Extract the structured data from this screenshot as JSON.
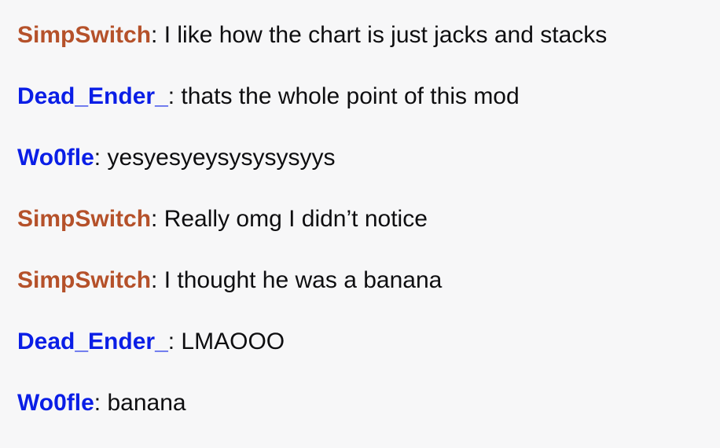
{
  "messages": [
    {
      "user": "SimpSwitch",
      "user_color": "#b5512a",
      "separator": ": ",
      "text": "I like how the chart is just jacks and stacks"
    },
    {
      "user": "Dead_Ender_",
      "user_color": "#0a1ee6",
      "separator": ": ",
      "text": "thats the whole point of this mod"
    },
    {
      "user": "Wo0fle",
      "user_color": "#0a1ee6",
      "separator": ": ",
      "text": "yesyesyeysysysysyys"
    },
    {
      "user": "SimpSwitch",
      "user_color": "#b5512a",
      "separator": ": ",
      "text": "Really omg I didn’t notice"
    },
    {
      "user": "SimpSwitch",
      "user_color": "#b5512a",
      "separator": ": ",
      "text": "I thought he was a banana"
    },
    {
      "user": "Dead_Ender_",
      "user_color": "#0a1ee6",
      "separator": ": ",
      "text": "LMAOOO"
    },
    {
      "user": "Wo0fle",
      "user_color": "#0a1ee6",
      "separator": ": ",
      "text": "banana"
    }
  ]
}
